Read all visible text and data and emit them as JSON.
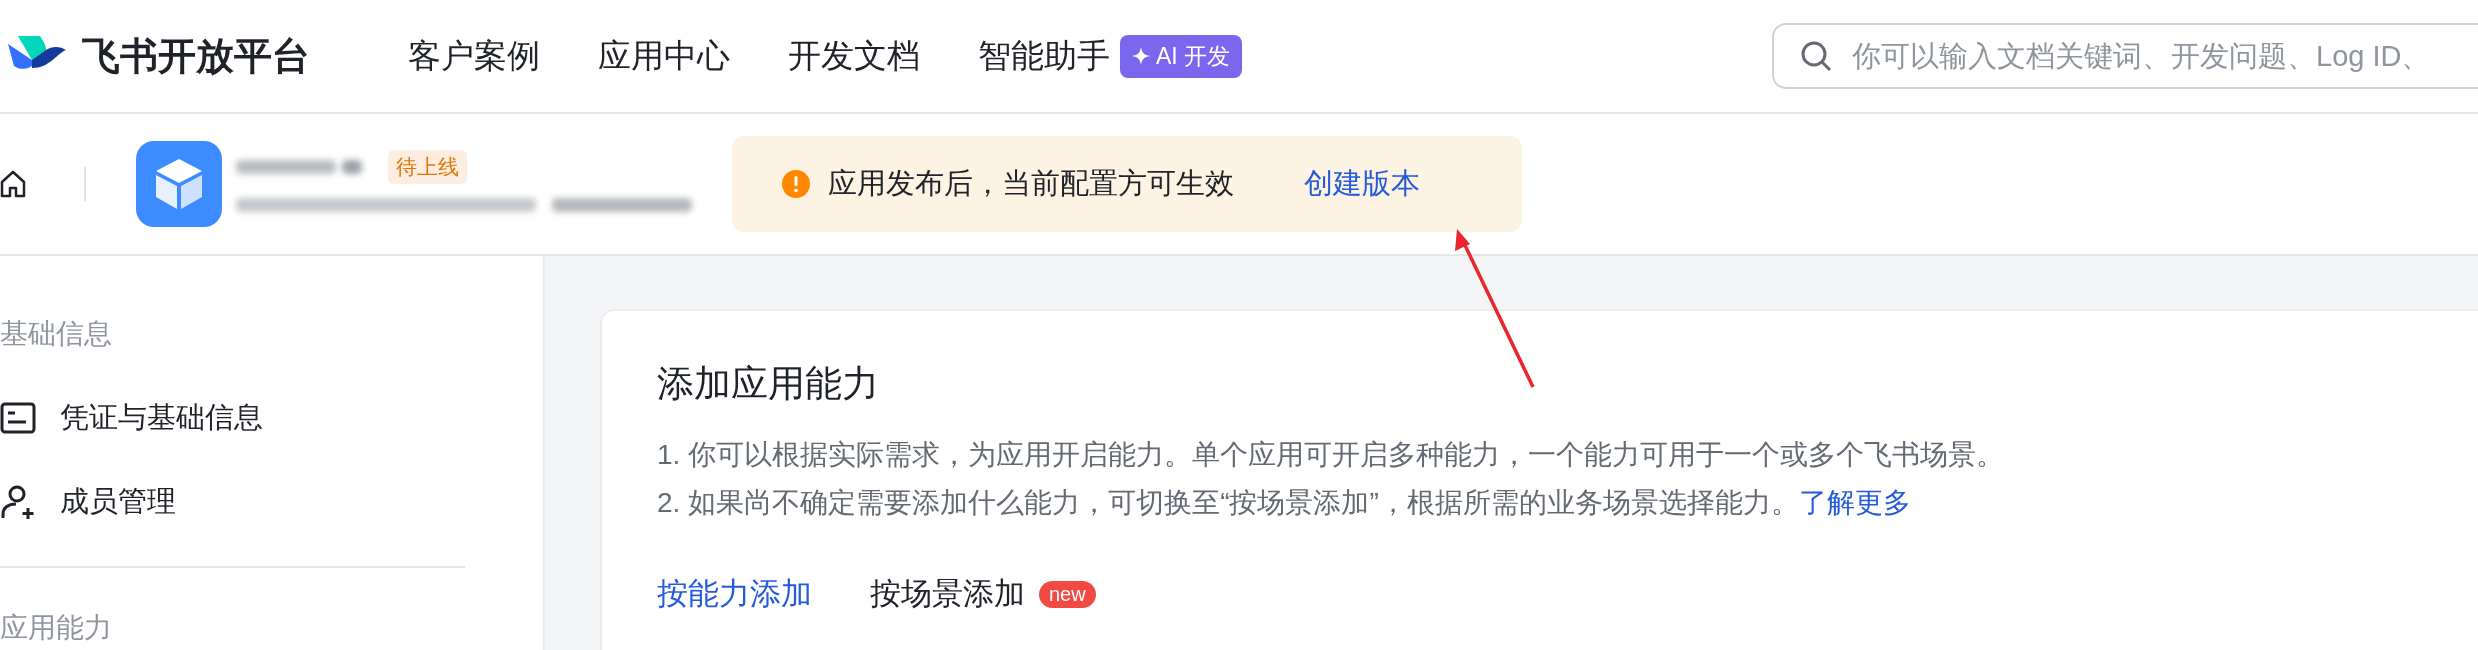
{
  "brand": {
    "name": "飞书开放平台"
  },
  "nav": [
    {
      "label": "客户案例"
    },
    {
      "label": "应用中心"
    },
    {
      "label": "开发文档"
    },
    {
      "label": "智能助手",
      "badge": "AI 开发"
    }
  ],
  "search": {
    "placeholder": "你可以输入文档关键词、开发问题、Log ID、"
  },
  "app": {
    "status": "待上线"
  },
  "notice": {
    "message": "应用发布后，当前配置方可生效",
    "link": "创建版本"
  },
  "sidebar": {
    "sections": [
      {
        "title": "基础信息",
        "items": [
          {
            "label": "凭证与基础信息",
            "kind": "credential"
          },
          {
            "label": "成员管理",
            "kind": "member"
          }
        ]
      },
      {
        "title": "应用能力"
      }
    ]
  },
  "card": {
    "title": "添加应用能力",
    "lines": [
      {
        "text": "1. 你可以根据实际需求，为应用开启能力。单个应用可开启多种能力，一个能力可用于一个或多个飞书场景。"
      },
      {
        "text": "2. 如果尚不确定需要添加什么能力，可切换至“按场景添加”，根据所需的业务场景选择能力。",
        "link": "了解更多"
      }
    ]
  },
  "tabs": [
    {
      "label": "按能力添加",
      "selected": true
    },
    {
      "label": "按场景添加",
      "selected": false,
      "badge": "new"
    }
  ]
}
